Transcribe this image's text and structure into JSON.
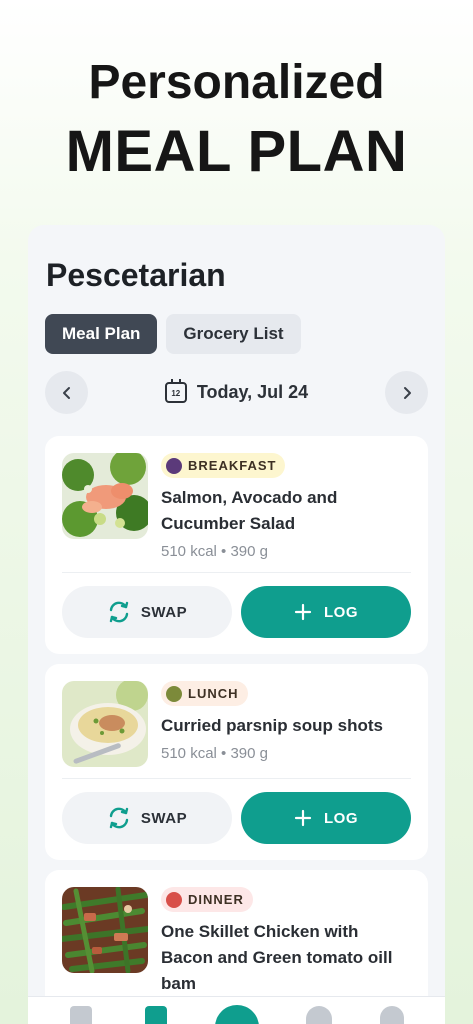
{
  "hero": {
    "line1": "Personalized",
    "line2": "MEAL PLAN"
  },
  "plan": {
    "title": "Pescetarian",
    "tabs": [
      {
        "label": "Meal Plan",
        "active": true
      },
      {
        "label": "Grocery List",
        "active": false
      }
    ],
    "date": {
      "label": "Today, Jul 24",
      "calendar_day": "12"
    }
  },
  "meals": [
    {
      "category": "BREAKFAST",
      "name": "Salmon, Avocado and Cucumber Salad",
      "meta": "510 kcal • 390 g",
      "swap_label": "SWAP",
      "log_label": "LOG"
    },
    {
      "category": "LUNCH",
      "name": "Curried parsnip soup shots",
      "meta": "510 kcal • 390 g",
      "swap_label": "SWAP",
      "log_label": "LOG"
    },
    {
      "category": "DINNER",
      "name": "One Skillet Chicken with Bacon and Green tomato oill bam"
    }
  ],
  "colors": {
    "accent": "#0f9e8e",
    "active_tab": "#404854"
  },
  "icons": [
    "chevron-left-icon",
    "chevron-right-icon",
    "calendar-icon",
    "swap-icon",
    "plus-icon"
  ]
}
